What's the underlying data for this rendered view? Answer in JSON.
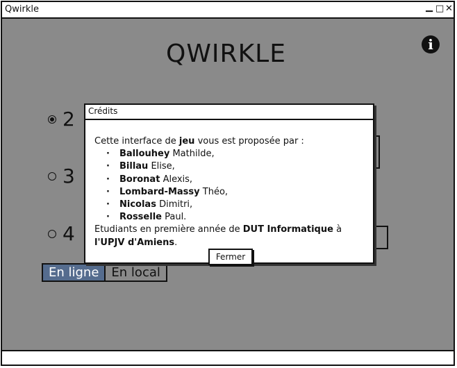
{
  "window": {
    "title": "Qwirkle",
    "controls": {
      "minimize": "▁",
      "maximize": "□",
      "close": "✕"
    }
  },
  "app": {
    "title": "QWIRKLE",
    "info_icon": "info-icon"
  },
  "player_options": [
    {
      "label": "2",
      "selected": true
    },
    {
      "label": "3",
      "selected": false
    },
    {
      "label": "4",
      "selected": false
    }
  ],
  "mode_tabs": [
    {
      "label": "En ligne",
      "active": true
    },
    {
      "label": "En local",
      "active": false
    }
  ],
  "dialog": {
    "title": "Crédits",
    "intro_before": "Cette interface de ",
    "intro_bold": "jeu",
    "intro_after": " vous est proposée par :",
    "authors": [
      {
        "last": "Ballouhey",
        "first": "Mathilde,"
      },
      {
        "last": "Billau",
        "first": "Elise,"
      },
      {
        "last": "Boronat",
        "first": "Alexis,"
      },
      {
        "last": "Lombard-Massy",
        "first": "Théo,"
      },
      {
        "last": "Nicolas",
        "first": "Dimitri,"
      },
      {
        "last": "Rosselle",
        "first": "Paul."
      }
    ],
    "footer_before": "Etudiants en première année de ",
    "footer_bold1": "DUT Informatique",
    "footer_mid": " à ",
    "footer_bold2": "l'UPJV d'Amiens",
    "footer_after": ".",
    "close_label": "Fermer"
  },
  "colors": {
    "background": "#8a8a8a",
    "active_tab": "#556c8e"
  }
}
